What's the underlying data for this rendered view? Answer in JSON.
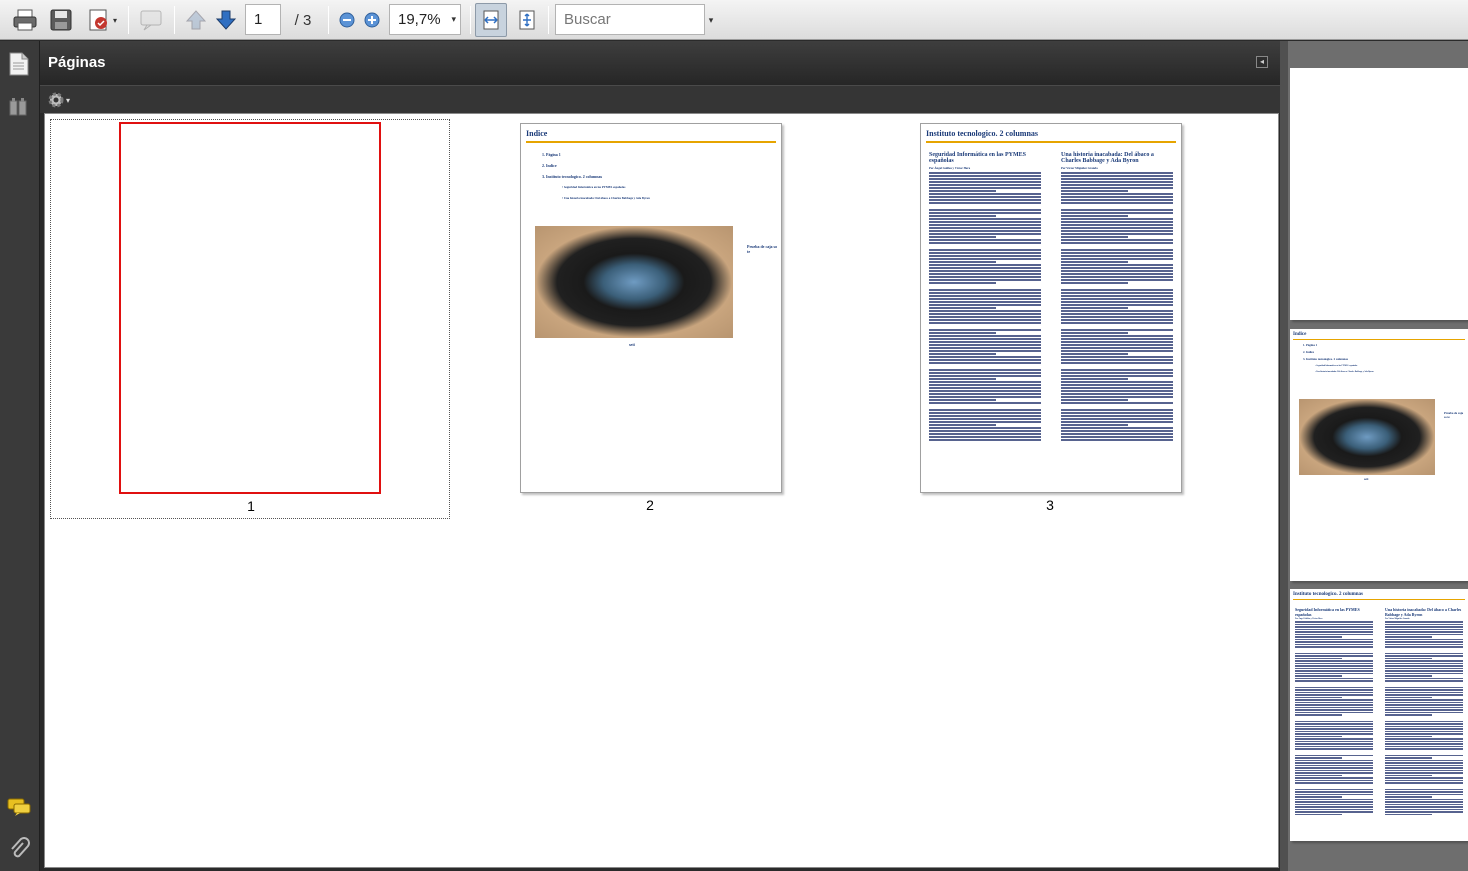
{
  "toolbar": {
    "page_current": "1",
    "page_total": "/ 3",
    "zoom": "19,7%",
    "search_placeholder": "Buscar"
  },
  "panel": {
    "title": "Páginas"
  },
  "thumbnails": [
    {
      "label": "1"
    },
    {
      "label": "2"
    },
    {
      "label": "3"
    }
  ],
  "page2": {
    "title": "Indice",
    "toc": [
      "Página 1",
      "Indice",
      "Instituto tecnologico. 2 columnas"
    ],
    "subtoc": [
      "Seguridad Informática en las PYMES españolas",
      "Una historia inacabada: Del ábaco a Charles Babbage y Ada Byron"
    ],
    "side_caption": "Prueba de caja so te",
    "caption": "seti"
  },
  "page3": {
    "title": "Instituto tecnologico. 2 columnas",
    "col1_heading": "Seguridad Informática en las PYMES españolas",
    "col1_byline": "Por Ángel Galilea y Víctor Hera",
    "col2_heading": "Una historia inacabada: Del ábaco a Charles Babbage y Ada Byron",
    "col2_byline": "Por Víctor Miguélez Granda"
  },
  "colors": {
    "selection": "#e01010",
    "gold_rule": "#e6a400",
    "heading_blue": "#1a3a78"
  },
  "icons": [
    "print-icon",
    "save-icon",
    "sign-icon",
    "comment-icon",
    "previous-page-icon",
    "next-page-icon",
    "zoom-out-icon",
    "zoom-in-icon",
    "dropdown-icon",
    "fit-width-icon",
    "fit-page-icon",
    "pages-icon",
    "bookmarks-icon",
    "options-gear-icon",
    "comments-icon",
    "attachments-icon",
    "collapse-panel-icon"
  ]
}
